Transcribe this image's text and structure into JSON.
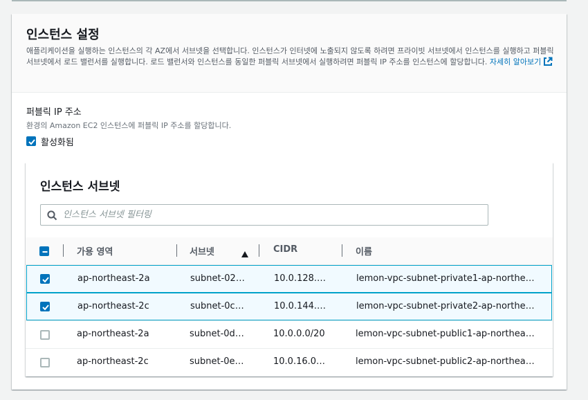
{
  "section": {
    "title": "인스턴스 설정",
    "description": "애플리케이션을 실행하는 인스턴스의 각 AZ에서 서브넷을 선택합니다. 인스턴스가 인터넷에 노출되지 않도록 하려면 프라이빗 서브넷에서 인스턴스를 실행하고 퍼블릭 서브넷에서 로드 밸런서를 실행합니다. 로드 밸런서와 인스턴스를 동일한 퍼블릭 서브넷에서 실행하려면 퍼블릭 IP 주소를 인스턴스에 할당합니다.",
    "learn_more": "자세히 알아보기"
  },
  "public_ip": {
    "label": "퍼블릭 IP 주소",
    "description": "환경의 Amazon EC2 인스턴스에 퍼블릭 IP 주소를 할당합니다.",
    "checkbox_label": "활성화됨",
    "checked": true
  },
  "subnets": {
    "title": "인스턴스 서브넷",
    "filter_placeholder": "인스턴스 서브넷 필터링",
    "columns": [
      "가용 영역",
      "서브넷",
      "CIDR",
      "이름"
    ],
    "rows": [
      {
        "az": "ap-northeast-2a",
        "subnet": "subnet-02…",
        "cidr": "10.0.128.…",
        "name": "lemon-vpc-subnet-private1-ap-northe…",
        "selected": true
      },
      {
        "az": "ap-northeast-2c",
        "subnet": "subnet-0c…",
        "cidr": "10.0.144.…",
        "name": "lemon-vpc-subnet-private2-ap-northe…",
        "selected": true
      },
      {
        "az": "ap-northeast-2a",
        "subnet": "subnet-0d…",
        "cidr": "10.0.0.0/20",
        "name": "lemon-vpc-subnet-public1-ap-northea…",
        "selected": false
      },
      {
        "az": "ap-northeast-2c",
        "subnet": "subnet-0e…",
        "cidr": "10.0.16.0…",
        "name": "lemon-vpc-subnet-public2-ap-northea…",
        "selected": false
      }
    ]
  },
  "colors": {
    "accent": "#0073bb",
    "selected_row_bg": "#f1faff",
    "selected_row_border": "#00a1c9"
  }
}
